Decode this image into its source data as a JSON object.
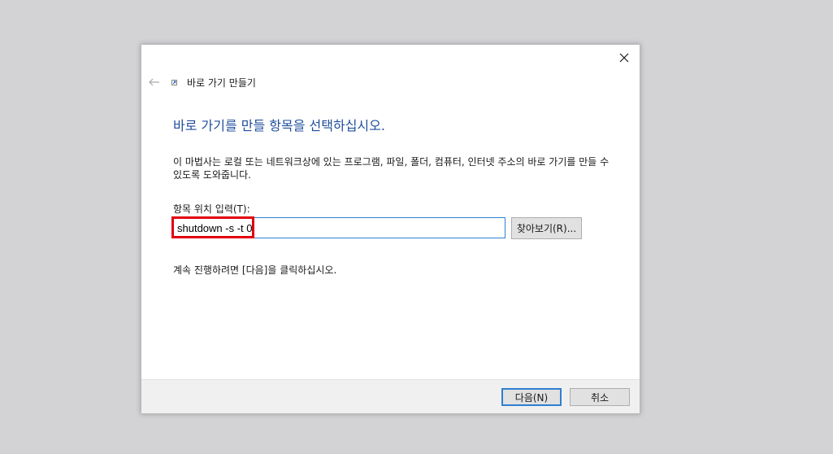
{
  "window": {
    "title": "바로 가기 만들기"
  },
  "icons": {
    "close": "close-icon",
    "back": "back-arrow-icon",
    "shortcut": "shortcut-icon"
  },
  "main": {
    "heading": "바로 가기를 만들 항목을 선택하십시오.",
    "description": "이 마법사는 로컬 또는 네트워크상에 있는 프로그램, 파일, 폴더, 컴퓨터, 인터넷 주소의 바로 가기를 만들 수 있도록 도와줍니다.",
    "location_label": "항목 위치 입력(T):",
    "location_value": "shutdown -s -t 0",
    "browse_label": "찾아보기(R)...",
    "instruction": "계속 진행하려면 [다음]을 클릭하십시오."
  },
  "footer": {
    "next_label": "다음(N)",
    "cancel_label": "취소"
  },
  "colors": {
    "heading": "#1f4e9d",
    "highlight": "#e3000f",
    "focus": "#2f7fd0"
  }
}
